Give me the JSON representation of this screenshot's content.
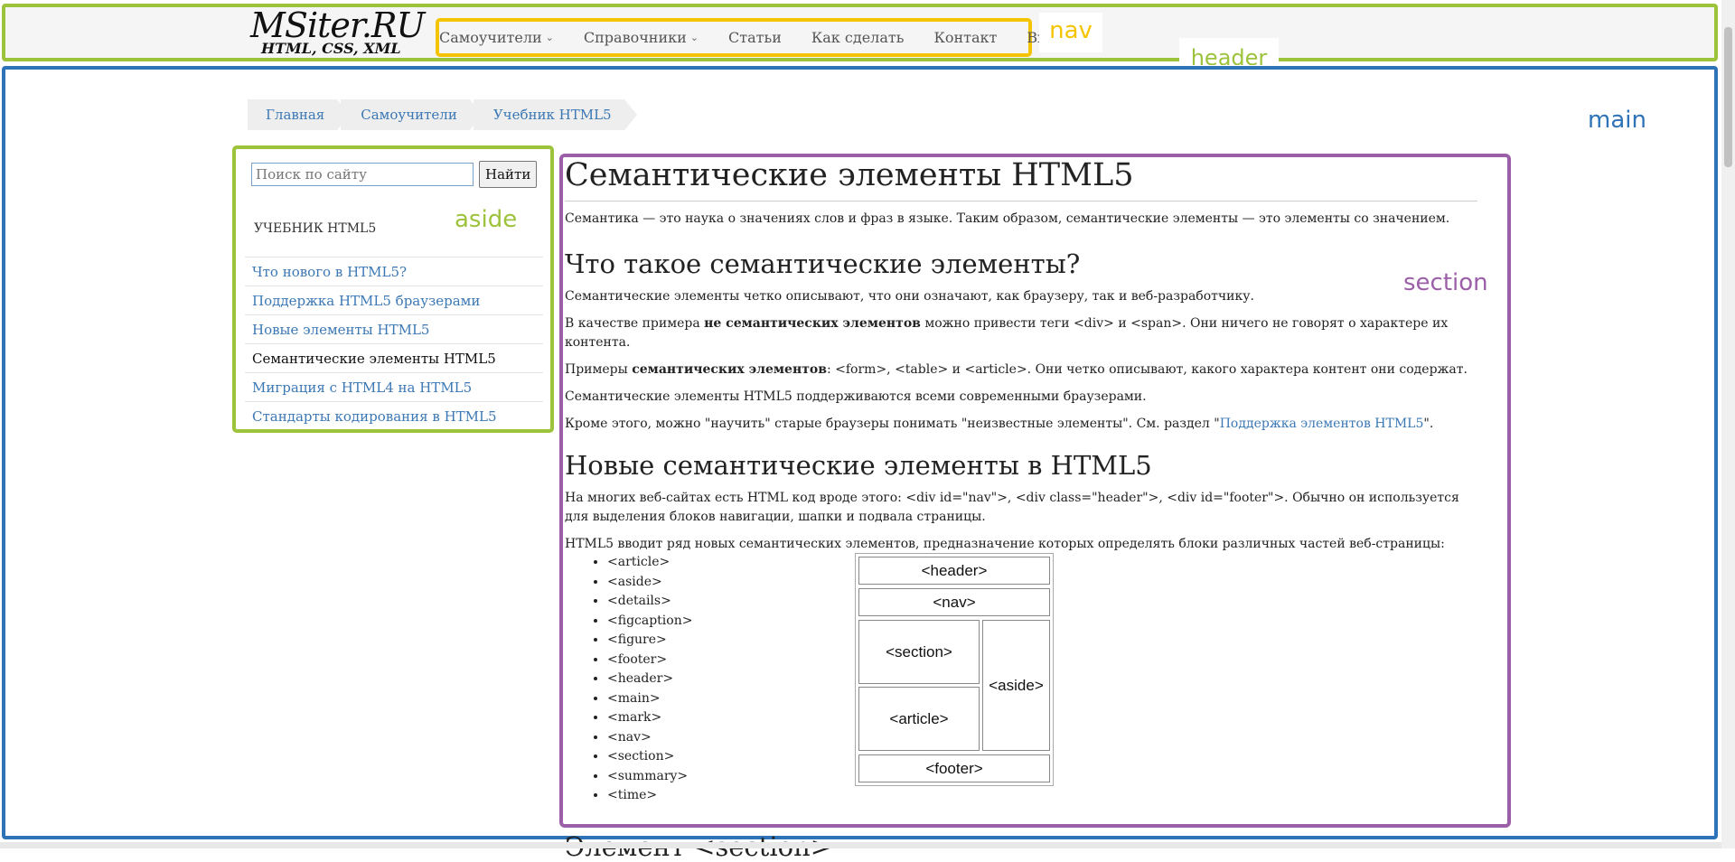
{
  "header": {
    "logo_title": "MSiter.RU",
    "logo_subtitle": "HTML, CSS, XML",
    "label": "header"
  },
  "nav": {
    "label": "nav",
    "items": [
      {
        "label": "Самоучители",
        "dropdown": true
      },
      {
        "label": "Справочники",
        "dropdown": true
      },
      {
        "label": "Статьи"
      },
      {
        "label": "Как сделать"
      },
      {
        "label": "Контакт"
      },
      {
        "label": "Вход"
      }
    ]
  },
  "main": {
    "label": "main",
    "breadcrumb": [
      "Главная",
      "Самоучители",
      "Учебник HTML5"
    ]
  },
  "aside": {
    "label": "aside",
    "search_placeholder": "Поиск по сайту",
    "search_button": "Найти",
    "heading": "УЧЕБНИК HTML5",
    "items": [
      "Что нового в HTML5?",
      "Поддержка HTML5 браузерами",
      "Новые элементы HTML5",
      "Семантические элементы HTML5",
      "Миграция с HTML4 на HTML5",
      "Стандарты кодирования в HTML5"
    ],
    "active_index": 3
  },
  "section": {
    "label": "section",
    "title": "Семантические элементы HTML5",
    "intro": "Семантика — это наука о значениях слов и фраз в языке. Таким образом, семантические элементы — это элементы со значением.",
    "h2_what": "Что такое семантические элементы?",
    "p1": "Семантические элементы четко описывают, что они означают, как браузеру, так и веб-разработчику.",
    "p2_before": "В качестве примера ",
    "p2_bold": "не семантических элементов",
    "p2_after": " можно привести теги <div> и <span>. Они ничего не говорят о характере их контента.",
    "p3_before": "Примеры ",
    "p3_bold": "семантических элементов",
    "p3_after": ": <form>, <table> и <article>. Они четко описывают, какого характера контент они содержат.",
    "p4": "Семантические элементы HTML5 поддерживаются всеми современными браузерами.",
    "p5_before": "Кроме этого, можно \"научить\" старые браузеры понимать \"неизвестные элементы\". См. раздел \"",
    "p5_link": "Поддержка элементов HTML5",
    "p5_after": "\".",
    "h2_new": "Новые семантические элементы в HTML5",
    "p6": "На многих веб-сайтах есть HTML код вроде этого: <div id=\"nav\">, <div class=\"header\">, <div id=\"footer\">. Обычно он используется для выделения блоков навигации, шапки и подвала страницы.",
    "p7": "HTML5 вводит ряд новых семантических элементов, предназначение которых определять блоки различных частей веб-страницы:",
    "elements": [
      "<article>",
      "<aside>",
      "<details>",
      "<figcaption>",
      "<figure>",
      "<footer>",
      "<header>",
      "<main>",
      "<mark>",
      "<nav>",
      "<section>",
      "<summary>",
      "<time>"
    ],
    "diagram": {
      "header": "<header>",
      "nav": "<nav>",
      "section": "<section>",
      "article": "<article>",
      "aside": "<aside>",
      "footer": "<footer>"
    },
    "next_heading": "Элемент <section>"
  }
}
